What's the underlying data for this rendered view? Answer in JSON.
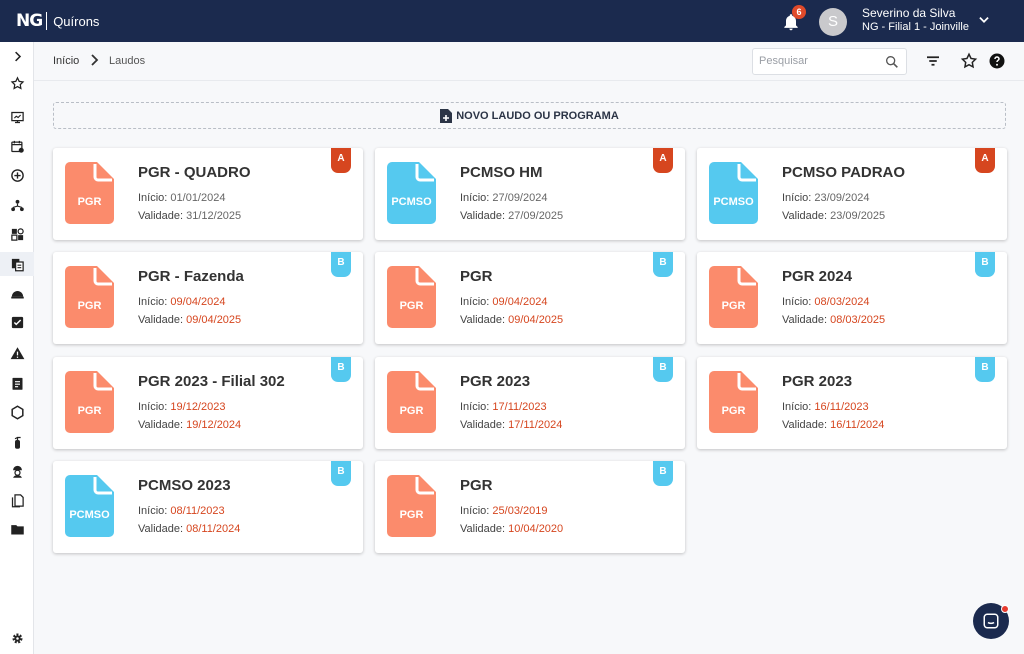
{
  "app": {
    "logo_mark": "NG",
    "logo_text": "Quírons"
  },
  "header": {
    "notifications_count": "6",
    "user_initial": "S",
    "user_name": "Severino da Silva",
    "user_branch": "NG - Filial 1 - Joinville"
  },
  "breadcrumb": {
    "home": "Início",
    "current": "Laudos"
  },
  "toolbar": {
    "search_placeholder": "Pesquisar",
    "search_value": ""
  },
  "new_button_label": "NOVO LAUDO OU PROGRAMA",
  "sidebar_icons": [
    "expand-icon",
    "star-icon",
    "dashboard-icon",
    "calendar-icon",
    "add-circle-icon",
    "org-chart-icon",
    "puzzle-icon",
    "documents-icon",
    "helmet-icon",
    "checklist-icon",
    "warning-icon",
    "clipboard-icon",
    "hexagon-icon",
    "extinguisher-icon",
    "worker-icon",
    "copy-icon",
    "folder-icon",
    "settings-icon"
  ],
  "colors": {
    "navy": "#1b2a4e",
    "pgr": "#fb8b6c",
    "pcmso": "#55c9ef",
    "tag_a": "#d6461f",
    "tag_b": "#55c9ef",
    "date_red": "#d6461f"
  },
  "cards": [
    {
      "title": "PGR - QUADRO",
      "icon_label": "PGR",
      "tag": "A",
      "start_label": "Início: ",
      "start": "01/01/2024",
      "valid_label": "Validade: ",
      "valid": "31/12/2025"
    },
    {
      "title": "PCMSO HM",
      "icon_label": "PCMSO",
      "tag": "A",
      "start_label": "Início: ",
      "start": "27/09/2024",
      "valid_label": "Validade: ",
      "valid": "27/09/2025"
    },
    {
      "title": "PCMSO PADRAO",
      "icon_label": "PCMSO",
      "tag": "A",
      "start_label": "Início: ",
      "start": "23/09/2024",
      "valid_label": "Validade: ",
      "valid": "23/09/2025"
    },
    {
      "title": "PGR - Fazenda",
      "icon_label": "PGR",
      "tag": "B",
      "start_label": "Início: ",
      "start": "09/04/2024",
      "valid_label": "Validade: ",
      "valid": "09/04/2025"
    },
    {
      "title": "PGR",
      "icon_label": "PGR",
      "tag": "B",
      "start_label": "Início: ",
      "start": "09/04/2024",
      "valid_label": "Validade: ",
      "valid": "09/04/2025"
    },
    {
      "title": "PGR 2024",
      "icon_label": "PGR",
      "tag": "B",
      "start_label": "Início: ",
      "start": "08/03/2024",
      "valid_label": "Validade: ",
      "valid": "08/03/2025"
    },
    {
      "title": "PGR 2023 - Filial 302",
      "icon_label": "PGR",
      "tag": "B",
      "start_label": "Início: ",
      "start": "19/12/2023",
      "valid_label": "Validade: ",
      "valid": "19/12/2024"
    },
    {
      "title": "PGR 2023",
      "icon_label": "PGR",
      "tag": "B",
      "start_label": "Início: ",
      "start": "17/11/2023",
      "valid_label": "Validade: ",
      "valid": "17/11/2024"
    },
    {
      "title": "PGR 2023",
      "icon_label": "PGR",
      "tag": "B",
      "start_label": "Início: ",
      "start": "16/11/2023",
      "valid_label": "Validade: ",
      "valid": "16/11/2024"
    },
    {
      "title": "PCMSO 2023",
      "icon_label": "PCMSO",
      "tag": "B",
      "start_label": "Início: ",
      "start": "08/11/2023",
      "valid_label": "Validade: ",
      "valid": "08/11/2024"
    },
    {
      "title": "PGR",
      "icon_label": "PGR",
      "tag": "B",
      "start_label": "Início: ",
      "start": "25/03/2019",
      "valid_label": "Validade: ",
      "valid": "10/04/2020"
    }
  ]
}
